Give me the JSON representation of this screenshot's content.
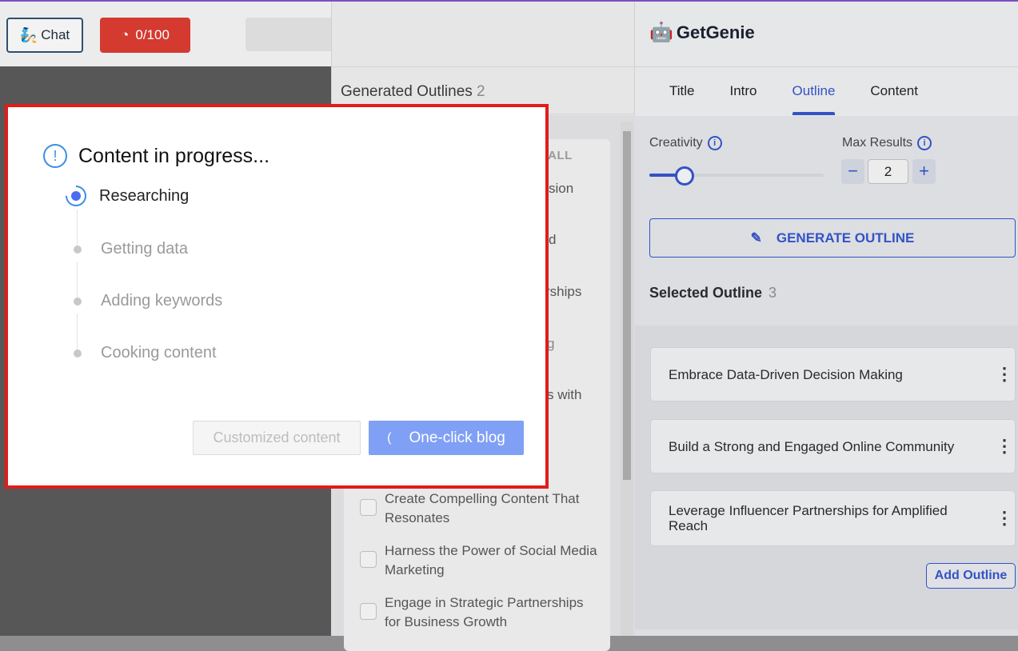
{
  "topbar": {
    "chat_label": "Chat",
    "credits_label": "0/100",
    "credits_icon": "gauge-icon"
  },
  "generated": {
    "title": "Generated Outlines",
    "count": "2",
    "select_all_fragment": "CT ALL",
    "hidden_fragments": [
      "sion",
      "d",
      "rships",
      "g",
      "s with"
    ],
    "items": [
      {
        "label": "Create Compelling Content That Resonates",
        "checked": false
      },
      {
        "label": "Harness the Power of Social Media Marketing",
        "checked": false
      },
      {
        "label": "Engage in Strategic Partnerships for Business Growth",
        "checked": false
      }
    ]
  },
  "brand": {
    "name": "GetGenie"
  },
  "tabs": [
    {
      "label": "Title"
    },
    {
      "label": "Intro"
    },
    {
      "label": "Outline",
      "active": true
    },
    {
      "label": "Content"
    }
  ],
  "controls": {
    "creativity_label": "Creativity",
    "creativity_value_fraction": 0.2,
    "max_results_label": "Max Results",
    "max_results_value": "2",
    "generate_label": "GENERATE OUTLINE"
  },
  "selected": {
    "title": "Selected Outline",
    "count": "3",
    "items": [
      {
        "label": "Embrace Data-Driven Decision Making"
      },
      {
        "label": "Build a Strong and Engaged Online Community"
      },
      {
        "label": "Leverage Influencer Partnerships for Amplified Reach"
      }
    ],
    "add_label": "Add Outline"
  },
  "modal": {
    "title": "Content in progress...",
    "steps": [
      {
        "label": "Researching",
        "status": "active"
      },
      {
        "label": "Getting data",
        "status": "pending"
      },
      {
        "label": "Adding keywords",
        "status": "pending"
      },
      {
        "label": "Cooking content",
        "status": "pending"
      }
    ],
    "customized_label": "Customized content",
    "oneclick_label": "One-click blog"
  },
  "colors": {
    "accent": "#3452c4",
    "modal_border": "#e21b1b",
    "credits": "#d43a2f",
    "progress": "#3a8ee6"
  }
}
